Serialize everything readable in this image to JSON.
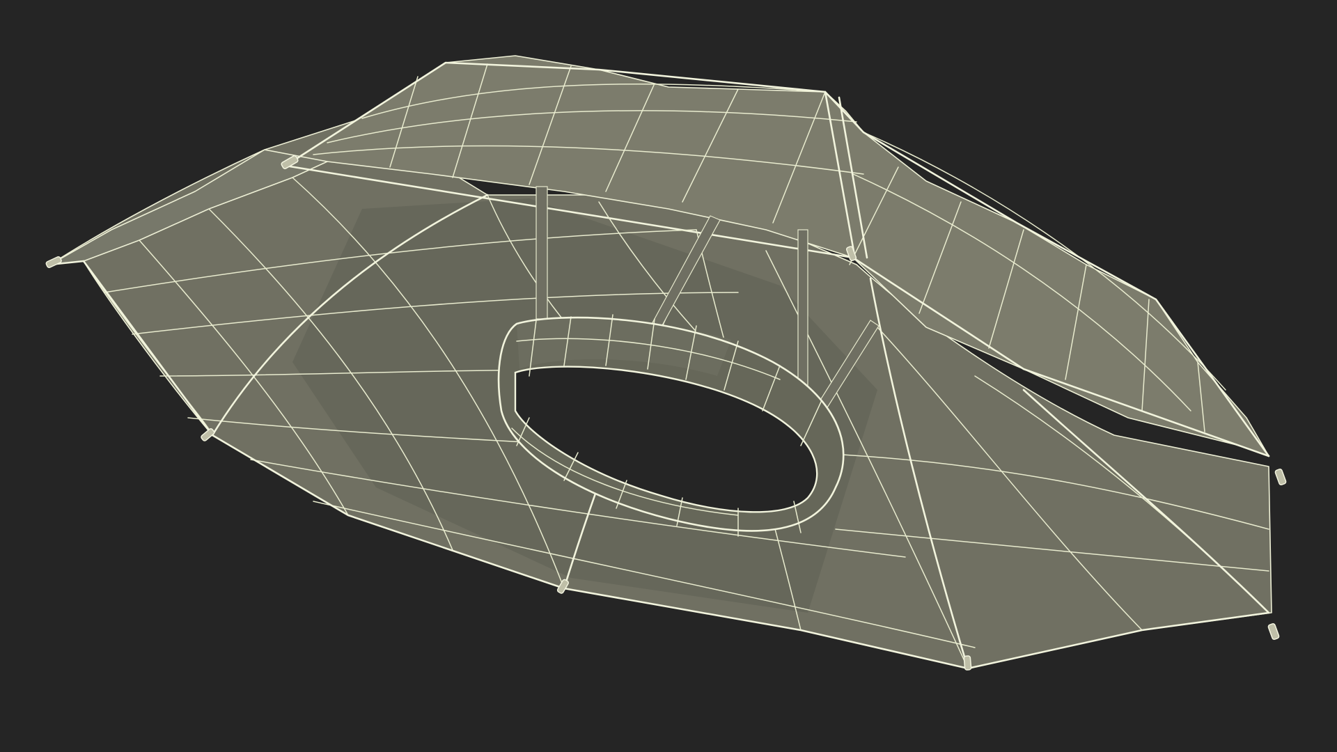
{
  "scene": {
    "subject": "umbrella-wireframe-render",
    "colors": {
      "background": "#252525",
      "canopy_shell": "#7b7b6c",
      "canopy_underside": "#6f6f61",
      "canopy_dark": "#5e5f53",
      "ring": "#656658",
      "wire": "#e9eccf"
    }
  }
}
